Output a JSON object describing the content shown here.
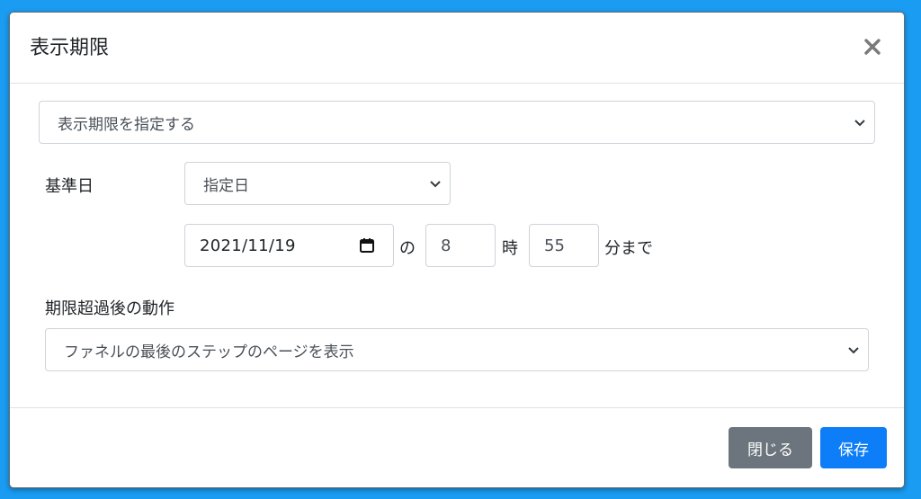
{
  "modal": {
    "title": "表示期限"
  },
  "mode_select": {
    "value": "表示期限を指定する"
  },
  "base_date": {
    "label": "基準日",
    "select_value": "指定日"
  },
  "deadline": {
    "date_value": "2021/11/19",
    "sep_no": "の",
    "hour_value": "8",
    "hour_suffix": "時",
    "minute_value": "55",
    "minute_suffix": "分まで"
  },
  "after_expiry": {
    "label": "期限超過後の動作",
    "select_value": "ファネルの最後のステップのページを表示"
  },
  "footer": {
    "close_label": "閉じる",
    "save_label": "保存"
  },
  "colors": {
    "background": "#1a9cf2",
    "primary": "#0d7ef7",
    "secondary": "#6c757d"
  }
}
